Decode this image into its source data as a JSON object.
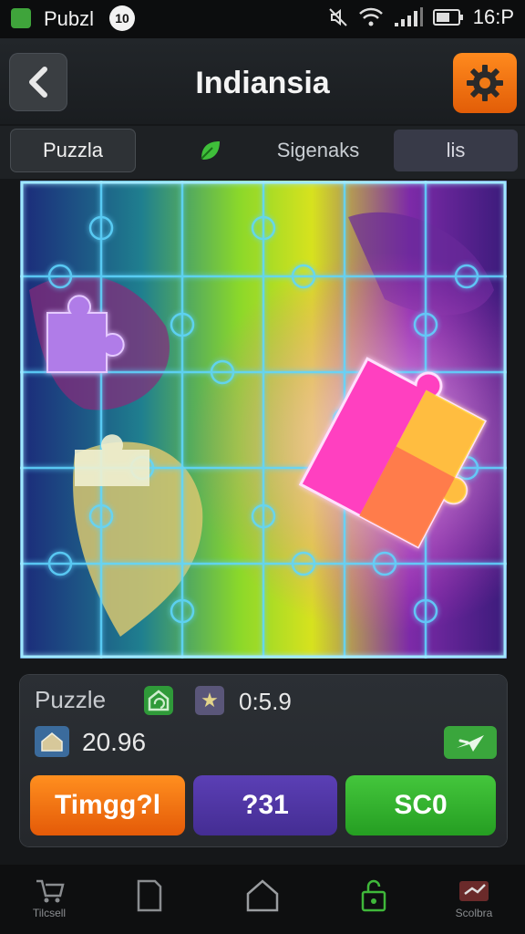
{
  "status_bar": {
    "app_name": "Pubzl",
    "badge_text": "10",
    "time": "16:P"
  },
  "header": {
    "title": "Indiansia",
    "back_icon": "chevron-left-icon",
    "settings_icon": "gear-icon"
  },
  "tabs": [
    {
      "label": "Puzzla",
      "selected": true
    },
    {
      "label": "",
      "icon": "leaf-icon"
    },
    {
      "label": "Sigenaks",
      "selected": false
    },
    {
      "label": "lis",
      "selected": false
    }
  ],
  "board": {
    "grid_columns": 6,
    "grid_rows": 5,
    "glow_colors": [
      "#33b6ff",
      "#c43cff",
      "#7dff3f"
    ]
  },
  "info": {
    "puzzle_label": "Puzzle",
    "time_value": "0:5.9",
    "score_value": "20.96"
  },
  "buttons": {
    "orange_label": "Timgg?l",
    "purple_label": "?31",
    "green_label": "SC0"
  },
  "bottom_nav": [
    {
      "label": "Tilcsell",
      "icon": "cart-icon"
    },
    {
      "label": "",
      "icon": "page-icon"
    },
    {
      "label": "",
      "icon": "home-icon"
    },
    {
      "label": "",
      "icon": "lock-icon"
    },
    {
      "label": "Scolbra",
      "icon": "chart-icon"
    }
  ],
  "colors": {
    "accent_orange": "#f07012",
    "accent_green": "#37b236",
    "accent_purple": "#4f36a6"
  }
}
